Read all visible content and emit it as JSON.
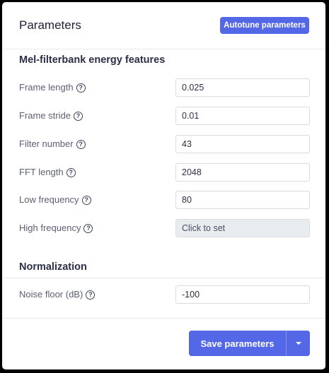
{
  "panel": {
    "title": "Parameters",
    "autotune_label": "Autotune parameters"
  },
  "mel_section": {
    "title": "Mel-filterbank energy features",
    "fields": [
      {
        "label": "Frame length",
        "value": "0.025"
      },
      {
        "label": "Frame stride",
        "value": "0.01"
      },
      {
        "label": "Filter number",
        "value": "43"
      },
      {
        "label": "FFT length",
        "value": "2048"
      },
      {
        "label": "Low frequency",
        "value": "80"
      },
      {
        "label": "High frequency",
        "value": "Click to set"
      }
    ]
  },
  "normalization": {
    "title": "Normalization",
    "fields": [
      {
        "label": "Noise floor (dB)",
        "value": "-100"
      }
    ]
  },
  "footer": {
    "save_label": "Save parameters"
  },
  "icons": {
    "help": "help-circle-icon",
    "dropdown": "chevron-down-icon"
  },
  "colors": {
    "accent": "#5468e7",
    "text_dark": "#1d2134",
    "text_label": "#5b5f73",
    "disabled_bg": "#e9ecef"
  }
}
